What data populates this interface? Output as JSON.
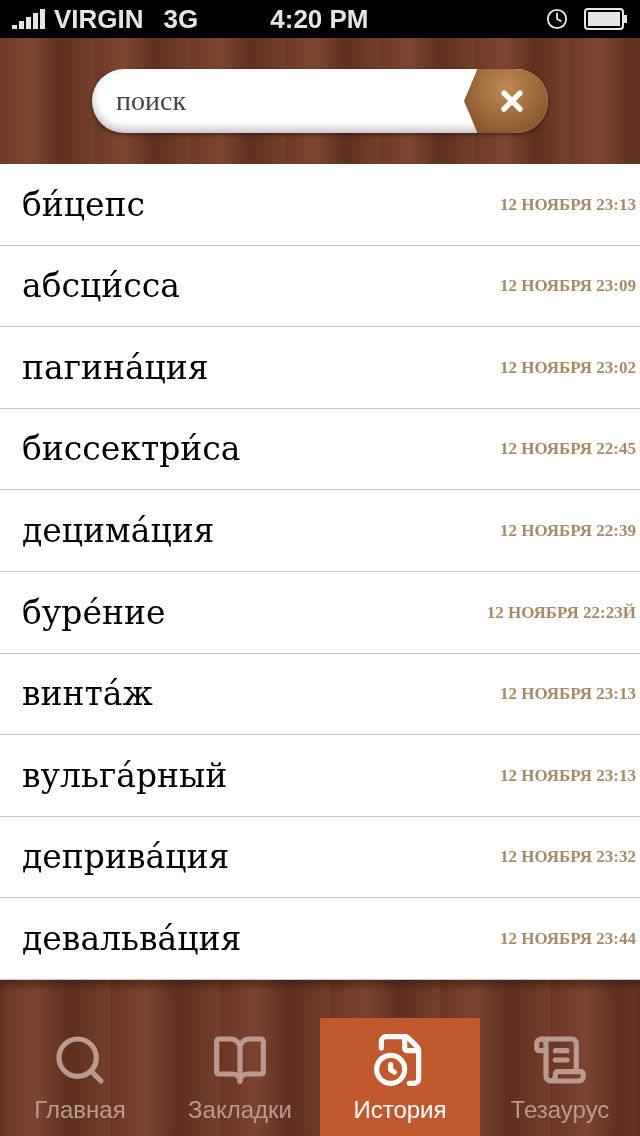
{
  "status_bar": {
    "carrier": "VIRGIN",
    "network": "3G",
    "time": "4:20 PM"
  },
  "search": {
    "placeholder": "поиск"
  },
  "history": [
    {
      "word": "би́цепс",
      "date": "12 НОЯБРЯ 23:13"
    },
    {
      "word": "абсци́сса",
      "date": "12 НОЯБРЯ 23:09"
    },
    {
      "word": "пагина́ция",
      "date": "12 НОЯБРЯ 23:02"
    },
    {
      "word": "биссектри́са",
      "date": "12 НОЯБРЯ 22:45"
    },
    {
      "word": "децима́ция",
      "date": "12 НОЯБРЯ 22:39"
    },
    {
      "word": "буре́ние",
      "date": "12 НОЯБРЯ 22:23Й"
    },
    {
      "word": "винта́ж",
      "date": "12 НОЯБРЯ 23:13"
    },
    {
      "word": "вульга́рный",
      "date": "12 НОЯБРЯ 23:13"
    },
    {
      "word": "деприва́ция",
      "date": "12 НОЯБРЯ 23:32"
    },
    {
      "word": "девальва́ция",
      "date": "12 НОЯБРЯ 23:44"
    }
  ],
  "tabs": [
    {
      "kind": "search",
      "label": "Главная",
      "selected": false
    },
    {
      "kind": "bookmarks",
      "label": "Закладки",
      "selected": false
    },
    {
      "kind": "history",
      "label": "История",
      "selected": true
    },
    {
      "kind": "thesaurus",
      "label": "Тезаурус",
      "selected": false
    }
  ]
}
